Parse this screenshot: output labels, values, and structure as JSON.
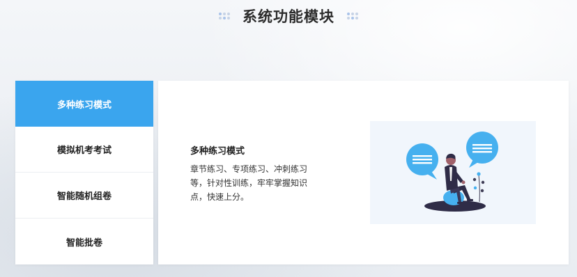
{
  "header": {
    "title": "系统功能模块"
  },
  "sidebar": {
    "items": [
      {
        "label": "多种练习模式"
      },
      {
        "label": "模拟机考考试"
      },
      {
        "label": "智能随机组卷"
      },
      {
        "label": "智能批卷"
      }
    ]
  },
  "content": {
    "title": "多种练习模式",
    "description": "章节练习、专项练习、冲刺练习等，针对性训练，牢牢掌握知识点，快速上分。",
    "illustration": "person-sitting-with-chat-bubbles-illustration"
  },
  "colors": {
    "accent": "#3aa5ee",
    "title_text": "#2b2b2b",
    "illustration_bg": "#f1f6fc"
  }
}
